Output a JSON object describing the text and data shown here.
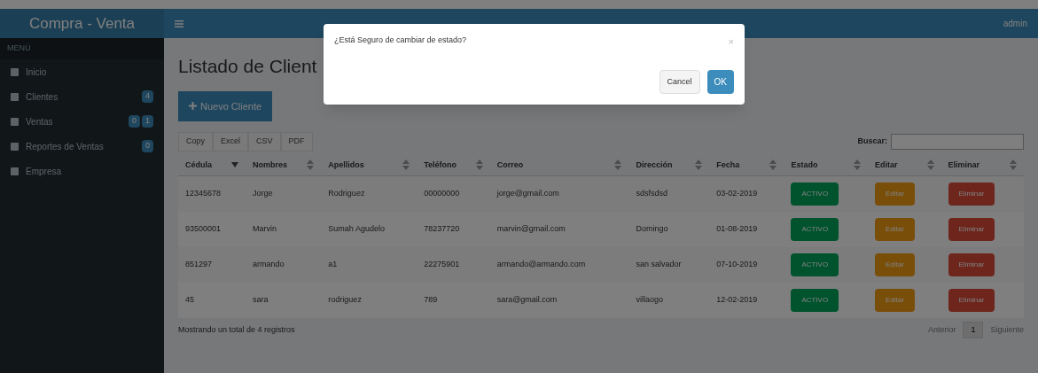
{
  "brand": "Compra - Venta",
  "user": "admin",
  "sidebar": {
    "header": "MENÚ",
    "items": [
      {
        "label": "Inicio"
      },
      {
        "label": "Clientes",
        "badges": [
          "4"
        ]
      },
      {
        "label": "Ventas",
        "badges": [
          "0",
          "1"
        ]
      },
      {
        "label": "Reportes de Ventas",
        "badges": [
          "0"
        ]
      },
      {
        "label": "Empresa"
      }
    ]
  },
  "page_title": "Listado de Client",
  "new_button": "Nuevo Cliente",
  "export_buttons": [
    "Copy",
    "Excel",
    "CSV",
    "PDF"
  ],
  "search_label": "Buscar:",
  "table": {
    "columns": [
      {
        "label": "Cédula",
        "selected": true
      },
      {
        "label": "Nombres",
        "selected": false
      },
      {
        "label": "Apellidos",
        "selected": false
      },
      {
        "label": "Teléfono",
        "selected": false
      },
      {
        "label": "Correo",
        "selected": false
      },
      {
        "label": "Dirección",
        "selected": false
      },
      {
        "label": "Fecha",
        "selected": false
      },
      {
        "label": "Estado",
        "selected": false
      },
      {
        "label": "Editar",
        "selected": false
      },
      {
        "label": "Eliminar",
        "selected": false
      }
    ],
    "rows": [
      {
        "cells": [
          "12345678",
          "Jorge",
          "Rodriguez",
          "00000000",
          "jorge@gmail.com",
          "sdsfsdsd",
          "03-02-2019"
        ],
        "status": "ACTIVO",
        "edit": "Editar",
        "delete": "Eliminar"
      },
      {
        "cells": [
          "93500001",
          "Marvin",
          "Sumah Agudelo",
          "78237720",
          "marvin@gmail.com",
          "Domingo",
          "01-08-2019"
        ],
        "status": "ACTIVO",
        "edit": "Editar",
        "delete": "Eliminar"
      },
      {
        "cells": [
          "851297",
          "armando",
          "a1",
          "22275901",
          "armando@armando.com",
          "san salvador",
          "07-10-2019"
        ],
        "status": "ACTIVO",
        "edit": "Editar",
        "delete": "Eliminar"
      },
      {
        "cells": [
          "45",
          "sara",
          "rodriguez",
          "789",
          "sara@gmail.com",
          "villaogo",
          "12-02-2019"
        ],
        "status": "ACTIVO",
        "edit": "Editar",
        "delete": "Eliminar"
      }
    ]
  },
  "footer_info": "Mostrando un total de 4 registros",
  "pagination": {
    "previous": "Anterior",
    "pages": [
      {
        "label": "1",
        "selected": true
      }
    ],
    "next": "Siguiente"
  },
  "dialog": {
    "message": "¿Está Seguro de cambiar de estado?",
    "close": "×",
    "buttons": [
      {
        "label": "Cancel",
        "kind": "default"
      },
      {
        "label": "OK",
        "kind": "primary"
      }
    ]
  }
}
